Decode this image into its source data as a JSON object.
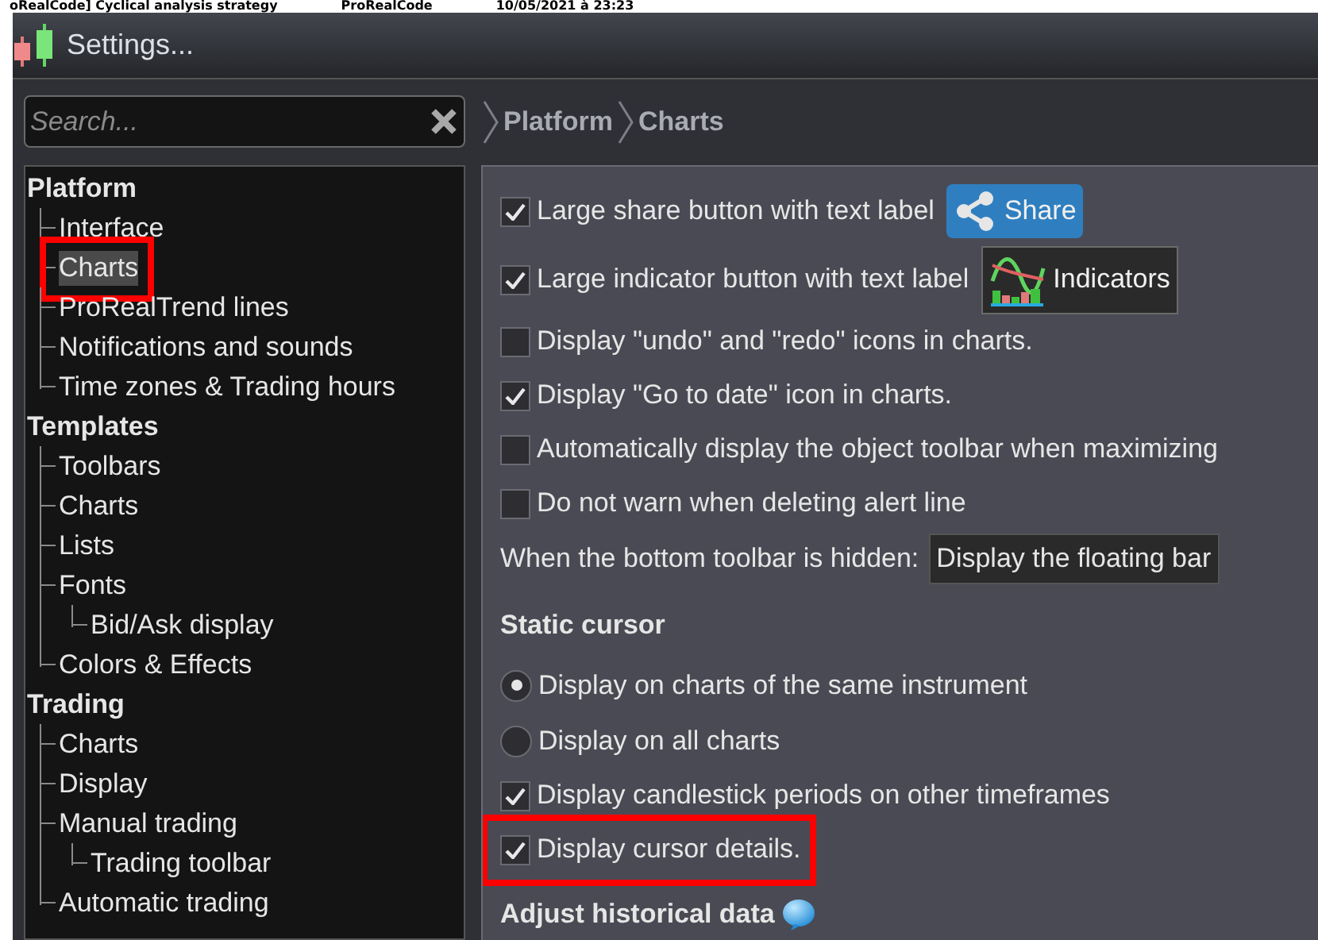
{
  "background_row": {
    "cells": [
      "oRealCode] Cyclical analysis strategy",
      "ProRealCode",
      "10/05/2021 à 23:23"
    ]
  },
  "window": {
    "title": "Settings..."
  },
  "search": {
    "placeholder": "Search..."
  },
  "breadcrumb": [
    "Platform",
    "Charts"
  ],
  "tree": [
    {
      "label": "Platform",
      "selected": false,
      "annotated": false,
      "children": [
        {
          "label": "Interface",
          "selected": false,
          "annotated": false
        },
        {
          "label": "Charts",
          "selected": true,
          "annotated": true
        },
        {
          "label": "ProRealTrend lines",
          "selected": false,
          "annotated": false
        },
        {
          "label": "Notifications and sounds",
          "selected": false,
          "annotated": false
        },
        {
          "label": "Time zones & Trading hours",
          "selected": false,
          "annotated": false
        }
      ]
    },
    {
      "label": "Templates",
      "selected": false,
      "annotated": false,
      "children": [
        {
          "label": "Toolbars",
          "selected": false,
          "annotated": false
        },
        {
          "label": "Charts",
          "selected": false,
          "annotated": false
        },
        {
          "label": "Lists",
          "selected": false,
          "annotated": false
        },
        {
          "label": "Fonts",
          "selected": false,
          "annotated": false,
          "children": [
            {
              "label": "Bid/Ask display",
              "selected": false,
              "annotated": false
            }
          ]
        },
        {
          "label": "Colors & Effects",
          "selected": false,
          "annotated": false
        }
      ]
    },
    {
      "label": "Trading",
      "selected": false,
      "annotated": false,
      "children": [
        {
          "label": "Charts",
          "selected": false,
          "annotated": false
        },
        {
          "label": "Display",
          "selected": false,
          "annotated": false
        },
        {
          "label": "Manual trading",
          "selected": false,
          "annotated": false,
          "children": [
            {
              "label": "Trading toolbar",
              "selected": false,
              "annotated": false
            }
          ]
        },
        {
          "label": "Automatic trading",
          "selected": false,
          "annotated": false
        }
      ]
    }
  ],
  "settings": [
    {
      "kind": "checkbox",
      "label": "Large share button with text label",
      "checked": true,
      "annotated": false,
      "sample": {
        "kind": "share",
        "label": "Share"
      }
    },
    {
      "kind": "checkbox",
      "label": "Large indicator button with text label",
      "checked": true,
      "annotated": false,
      "sample": {
        "kind": "indicators",
        "label": "Indicators"
      }
    },
    {
      "kind": "checkbox",
      "label": "Display \"undo\" and \"redo\" icons in charts.",
      "checked": false,
      "annotated": false
    },
    {
      "kind": "checkbox",
      "label": "Display \"Go to date\" icon in charts.",
      "checked": true,
      "annotated": false
    },
    {
      "kind": "checkbox",
      "label": "Automatically display the object toolbar when maximizing",
      "checked": false,
      "annotated": false
    },
    {
      "kind": "checkbox",
      "label": "Do not warn when deleting alert line",
      "checked": false,
      "annotated": false
    },
    {
      "kind": "select",
      "label": "When the bottom toolbar is hidden:",
      "value": "Display the floating bar"
    },
    {
      "kind": "heading",
      "label": "Static cursor"
    },
    {
      "kind": "radio",
      "label": "Display on charts of the same instrument",
      "selected": true
    },
    {
      "kind": "radio",
      "label": "Display on all charts",
      "selected": false
    },
    {
      "kind": "checkbox",
      "label": "Display candlestick periods on other timeframes",
      "checked": true,
      "annotated": false
    },
    {
      "kind": "checkbox",
      "label": "Display cursor details.",
      "checked": true,
      "annotated": true
    },
    {
      "kind": "heading_with_help",
      "label": "Adjust historical data"
    }
  ]
}
